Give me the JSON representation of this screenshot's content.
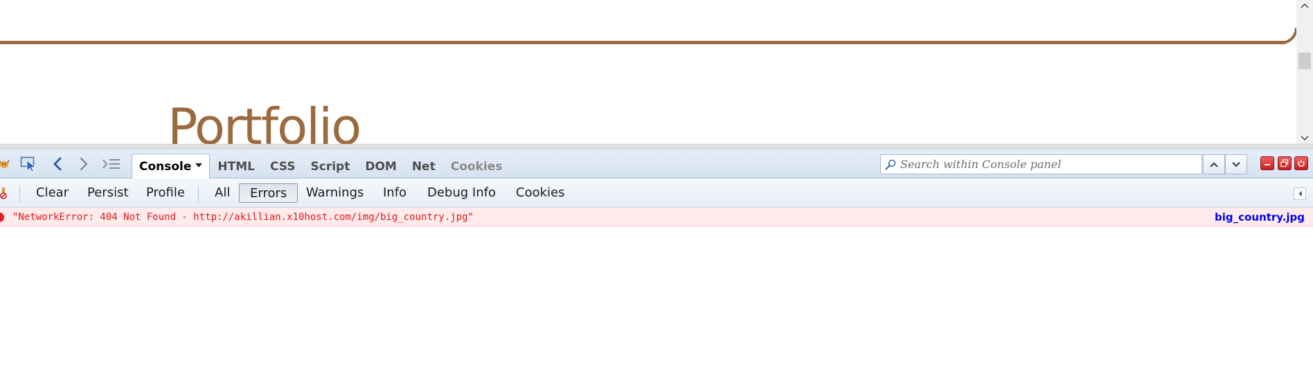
{
  "page": {
    "heading": "Portfolio"
  },
  "firebug": {
    "panel_tabs": [
      {
        "label": "Console",
        "active": true
      },
      {
        "label": "HTML"
      },
      {
        "label": "CSS"
      },
      {
        "label": "Script"
      },
      {
        "label": "DOM"
      },
      {
        "label": "Net"
      },
      {
        "label": "Cookies",
        "dimmed": true
      }
    ],
    "search": {
      "placeholder": "Search within Console panel"
    },
    "icons": {
      "logo": "firebug-icon",
      "inspect": "inspect-element-icon",
      "back": "back-arrow-icon",
      "forward": "forward-arrow-icon",
      "stack": "stack-icon",
      "search": "magnifier-icon",
      "prev": "chevron-up-icon",
      "next": "chevron-down-icon",
      "minimize": "minimize-icon",
      "detach": "detach-icon",
      "close": "power-close-icon"
    }
  },
  "console_toolbar": {
    "clear": "Clear",
    "persist": "Persist",
    "profile": "Profile",
    "filters": {
      "all": "All",
      "errors": "Errors",
      "warnings": "Warnings",
      "info": "Info",
      "debug_info": "Debug Info",
      "cookies": "Cookies"
    },
    "active_filter": "Errors"
  },
  "log": [
    {
      "level": "error",
      "message": "\"NetworkError: 404 Not Found - http://akillian.x10host.com/img/big_country.jpg\"",
      "source": "big_country.jpg"
    }
  ],
  "colors": {
    "accent_brown": "#9b6a3f",
    "error_text": "#e01818",
    "error_bg": "#ffebeb",
    "link_blue": "#0000ff"
  }
}
